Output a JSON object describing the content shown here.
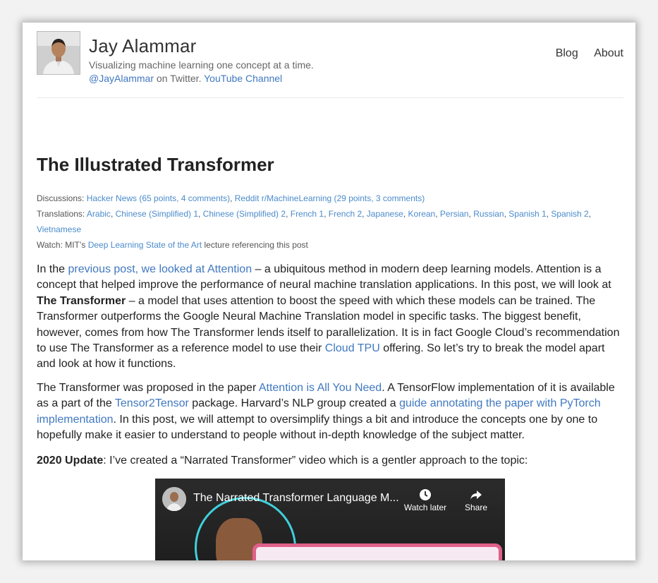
{
  "site": {
    "name": "Jay Alammar",
    "tagline": "Visualizing machine learning one concept at a time.",
    "twitter_handle": "@JayAlammar",
    "twitter_suffix": " on Twitter. ",
    "youtube": "YouTube Channel"
  },
  "nav": {
    "items": [
      "Blog",
      "About"
    ]
  },
  "post": {
    "title": "The Illustrated Transformer",
    "discussions": {
      "label": "Discussions: ",
      "links": [
        "Hacker News (65 points, 4 comments)",
        "Reddit r/MachineLearning (29 points, 3 comments)"
      ],
      "sep": ", "
    },
    "translations": {
      "label": "Translations: ",
      "links": [
        "Arabic",
        "Chinese (Simplified) 1",
        "Chinese (Simplified) 2",
        "French 1",
        "French 2",
        "Japanese",
        "Korean",
        "Persian",
        "Russian",
        "Spanish 1",
        "Spanish 2",
        "Vietnamese"
      ]
    },
    "watch": {
      "prefix": "Watch: MIT’s ",
      "link": "Deep Learning State of the Art",
      "suffix": " lecture referencing this post"
    },
    "p1": {
      "t1": "In the ",
      "l1": "previous post, we looked at Attention",
      "t2": " – a ubiquitous method in modern deep learning models. Attention is a concept that helped improve the performance of neural machine translation applications. In this post, we will look at ",
      "b1": "The Transformer",
      "t3": " – a model that uses attention to boost the speed with which these models can be trained. The Transformer outperforms the Google Neural Machine Translation model in specific tasks. The biggest benefit, however, comes from how The Transformer lends itself to parallelization. It is in fact Google Cloud’s recommendation to use The Transformer as a reference model to use their ",
      "l2": "Cloud TPU",
      "t4": " offering. So let’s try to break the model apart and look at how it functions."
    },
    "p2": {
      "t1": "The Transformer was proposed in the paper ",
      "l1": "Attention is All You Need",
      "t2": ". A TensorFlow implementation of it is available as a part of the ",
      "l2": "Tensor2Tensor",
      "t3": " package. Harvard’s NLP group created a ",
      "l3": "guide annotating the paper with PyTorch implementation",
      "t4": ". In this post, we will attempt to oversimplify things a bit and introduce the concepts one by one to hopefully make it easier to understand to people without in-depth knowledge of the subject matter."
    },
    "p3": {
      "b1": "2020 Update",
      "t1": ": I’ve created a “Narrated Transformer” video which is a gentler approach to the topic:"
    },
    "video": {
      "title": "The Narrated Transformer Language M...",
      "watch_later": "Watch later",
      "share": "Share"
    }
  },
  "colors": {
    "link": "#4078c0",
    "meta_link": "#4b8bcb",
    "video_ring": "#3fd0dc",
    "video_box_border": "#e0608a"
  },
  "icons": [
    "clock-icon",
    "share-arrow-icon"
  ]
}
